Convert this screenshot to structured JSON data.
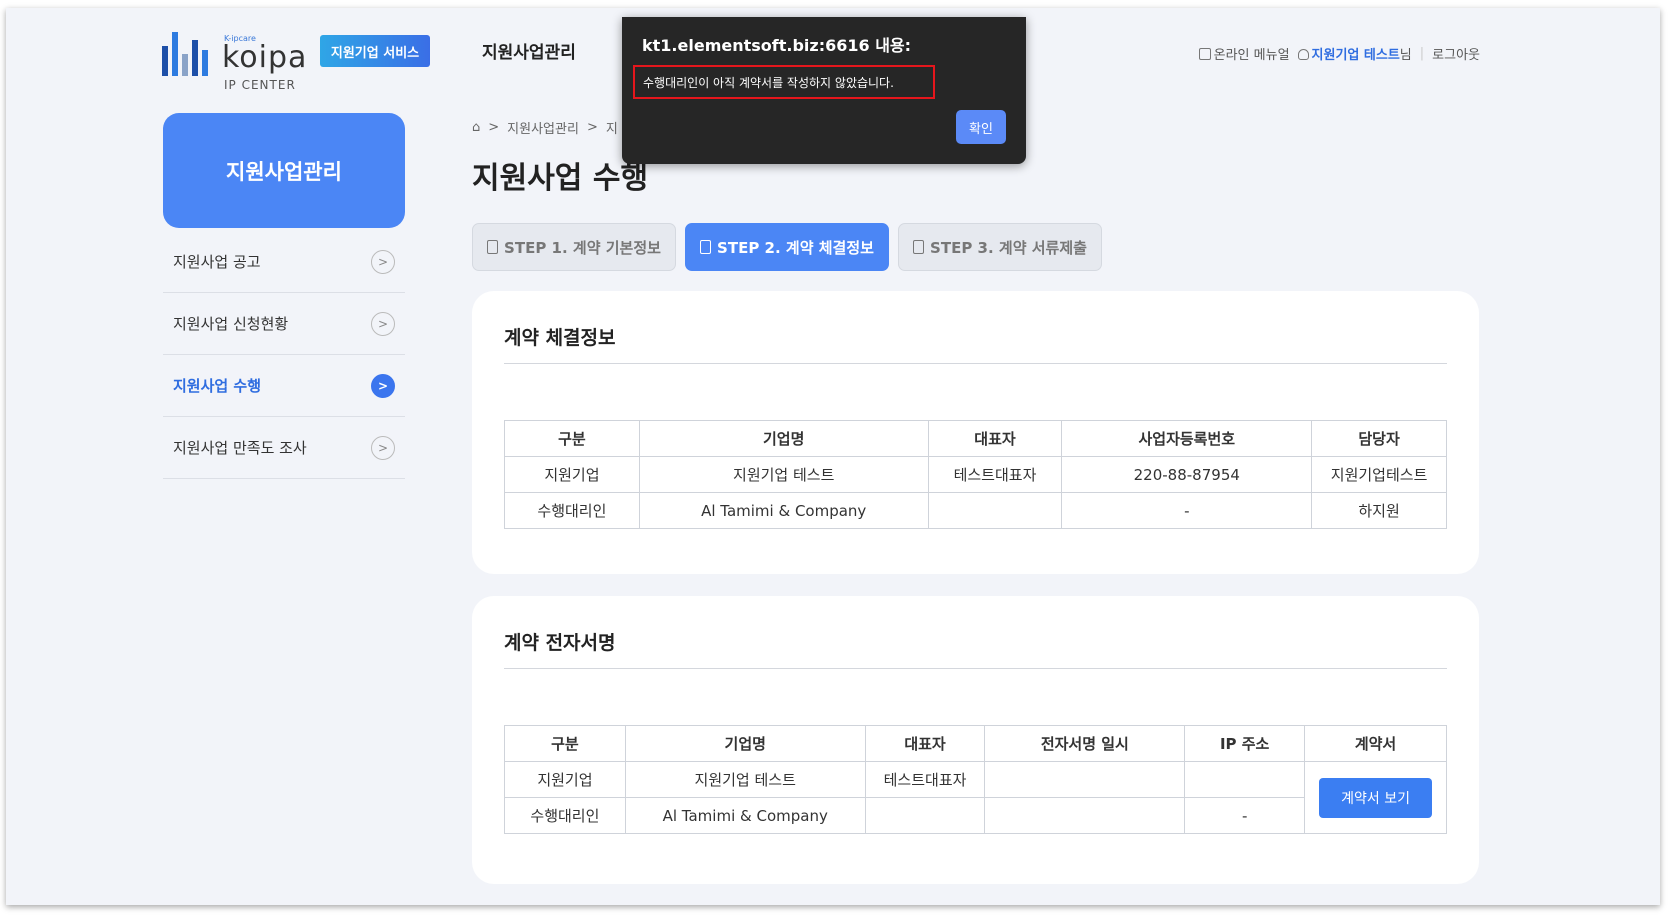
{
  "header": {
    "logo_kicker": "K-ipcare",
    "logo_word": "koipa",
    "logo_sub": "IP CENTER",
    "service_badge": "지원기업 서비스",
    "gnb_item": "지원사업관리",
    "util": {
      "manual": "온라인 메뉴얼",
      "user_name": "지원기업 테스트",
      "user_suffix": "님",
      "logout": "로그아웃"
    }
  },
  "sidebar": {
    "title": "지원사업관리",
    "items": [
      {
        "label": "지원사업 공고"
      },
      {
        "label": "지원사업 신청현황"
      },
      {
        "label": "지원사업 수행"
      },
      {
        "label": "지원사업 만족도 조사"
      }
    ],
    "active_index": 2
  },
  "breadcrumb": [
    "지원사업관리",
    "지"
  ],
  "page_title": "지원사업 수행",
  "steps": [
    {
      "label": "STEP 1. 계약 기본정보"
    },
    {
      "label": "STEP 2. 계약 체결정보"
    },
    {
      "label": "STEP 3. 계약 서류제출"
    }
  ],
  "contract_info": {
    "title": "계약 체결정보",
    "headers": [
      "구분",
      "기업명",
      "대표자",
      "사업자등록번호",
      "담당자"
    ],
    "rows": [
      [
        "지원기업",
        "지원기업 테스트",
        "테스트대표자",
        "220-88-87954",
        "지원기업테스트"
      ],
      [
        "수행대리인",
        "Al Tamimi & Company",
        "",
        "-",
        "하지원"
      ]
    ]
  },
  "esign": {
    "title": "계약 전자서명",
    "headers": [
      "구분",
      "기업명",
      "대표자",
      "전자서명 일시",
      "IP 주소",
      "계약서"
    ],
    "rows": [
      [
        "지원기업",
        "지원기업 테스트",
        "테스트대표자",
        "",
        ""
      ],
      [
        "수행대리인",
        "Al Tamimi & Company",
        "",
        "",
        "-"
      ]
    ],
    "view_button": "계약서 보기"
  },
  "dialog": {
    "title": "kt1.elementsoft.biz:6616 내용:",
    "message": "수행대리인이 아직 계약서를 작성하지 않았습니다.",
    "ok": "확인"
  },
  "colors": {
    "accent": "#4b86f5",
    "button": "#3b7ef2",
    "highlight_border": "#e5161c",
    "background": "#f2f4f9"
  }
}
